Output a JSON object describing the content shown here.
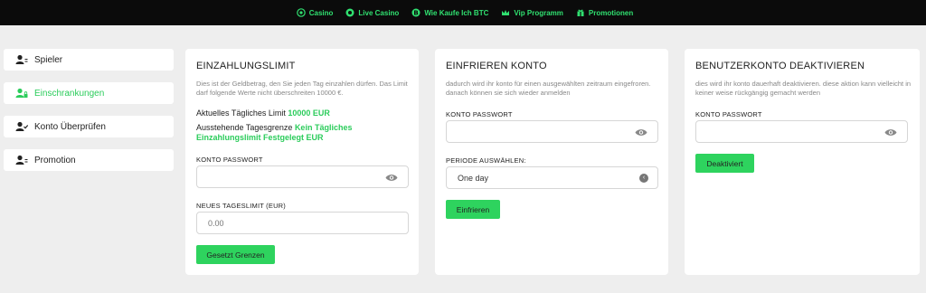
{
  "colors": {
    "accent": "#2ed35e",
    "nav_bg": "#0b0b0b",
    "nav_text": "#30e070"
  },
  "nav": [
    {
      "label": "Casino",
      "icon": "casino-icon"
    },
    {
      "label": "Live Casino",
      "icon": "live-casino-icon"
    },
    {
      "label": "Wie Kaufe Ich BTC",
      "icon": "bitcoin-icon"
    },
    {
      "label": "Vip Programm",
      "icon": "crown-icon"
    },
    {
      "label": "Promotionen",
      "icon": "gift-icon"
    }
  ],
  "sidebar": [
    {
      "label": "Spieler",
      "icon": "user-icon"
    },
    {
      "label": "Einschrankungen",
      "icon": "user-lock-icon",
      "active": true
    },
    {
      "label": "Konto Überprüfen",
      "icon": "user-check-icon"
    },
    {
      "label": "Promotion",
      "icon": "user-icon"
    }
  ],
  "deposit": {
    "title": "EINZAHLUNGSLIMIT",
    "desc": "Dies ist der Geldbetrag, den Sie jeden Tag einzahlen dürfen. Das Limit darf folgende Werte nicht überschreiten 10000 €.",
    "current_prefix": "Aktuelles Tägliches Limit",
    "current_value": "10000 EUR",
    "pending_prefix": "Ausstehende Tagesgrenze",
    "pending_value": "Kein Tägliches Einzahlungslimit Festgelegt EUR",
    "password_label": "KONTO PASSWORT",
    "limit_label": "NEUES TAGESLIMIT (EUR)",
    "limit_placeholder": "0.00",
    "button": "Gesetzt Grenzen"
  },
  "freeze": {
    "title": "EINFRIEREN KONTO",
    "desc": "dadurch wird ihr konto für einen ausgewählten zeitraum eingefroren. danach können sie sich wieder anmelden",
    "password_label": "KONTO PASSWORT",
    "period_label": "PERIODE AUSWÄHLEN:",
    "period_value": "One day",
    "button": "Einfrieren"
  },
  "deactivate": {
    "title": "BENUTZERKONTO DEAKTIVIEREN",
    "desc": "dies wird ihr konto dauerhaft deaktivieren. diese aktion kann vielleicht in keiner weise rückgängig gemacht werden",
    "password_label": "KONTO PASSWORT",
    "button": "Deaktiviert"
  }
}
